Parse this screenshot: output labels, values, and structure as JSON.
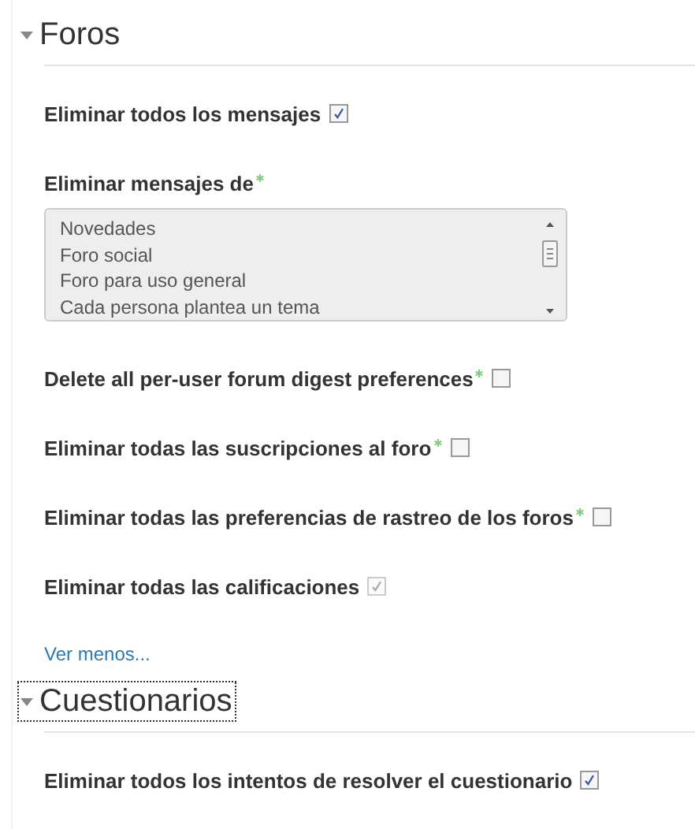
{
  "sections": [
    {
      "title": "Foros",
      "expanded": true,
      "focused": false,
      "items": [
        {
          "kind": "checkbox",
          "label": "Eliminar todos los mensajes",
          "required": false,
          "checked": true,
          "disabled": false
        },
        {
          "kind": "listbox",
          "label": "Eliminar mensajes de",
          "required": true,
          "options": [
            "Novedades",
            "Foro social",
            "Foro para uso general",
            "Cada persona plantea un tema"
          ]
        },
        {
          "kind": "checkbox",
          "label": "Delete all per-user forum digest preferences",
          "required": true,
          "checked": false,
          "disabled": false
        },
        {
          "kind": "checkbox",
          "label": "Eliminar todas las suscripciones al foro",
          "required": true,
          "checked": false,
          "disabled": false
        },
        {
          "kind": "checkbox",
          "label": "Eliminar todas las preferencias de rastreo de los foros",
          "required": true,
          "checked": false,
          "disabled": false
        },
        {
          "kind": "checkbox",
          "label": "Eliminar todas las calificaciones",
          "required": false,
          "checked": true,
          "disabled": true
        },
        {
          "kind": "link",
          "label": "Ver menos..."
        }
      ]
    },
    {
      "title": "Cuestionarios",
      "expanded": true,
      "focused": true,
      "items": [
        {
          "kind": "checkbox",
          "label": "Eliminar todos los intentos de resolver el cuestionario",
          "required": false,
          "checked": true,
          "disabled": false
        }
      ]
    }
  ]
}
